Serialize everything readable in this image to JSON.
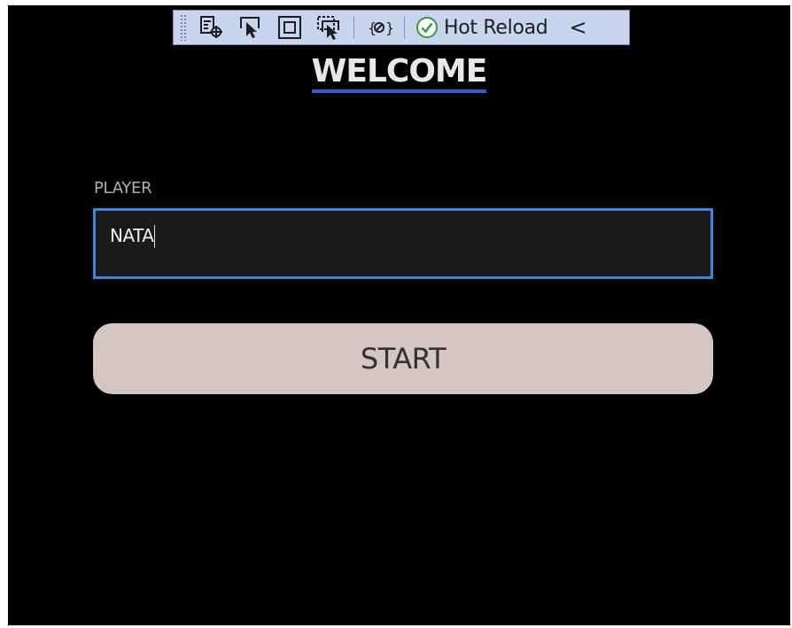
{
  "toolbar": {
    "items": [
      {
        "icon": "live-visual-tree-icon"
      },
      {
        "icon": "select-element-icon"
      },
      {
        "icon": "display-layout-adorners-icon"
      },
      {
        "icon": "track-focused-element-icon"
      },
      {
        "icon": "binding-failures-icon"
      }
    ],
    "hot_reload_label": "Hot Reload",
    "collapse_glyph": "<"
  },
  "app": {
    "title": "WELCOME",
    "player_label": "PLAYER",
    "player_value": "NATA",
    "start_label": "START"
  },
  "colors": {
    "background": "#000000",
    "toolbar": "#c9d4ef",
    "title_underline": "#2f62d8",
    "input_border": "#3d86d9",
    "button_bg": "#d5c5c3",
    "hot_reload_check": "#2e9e3a"
  }
}
